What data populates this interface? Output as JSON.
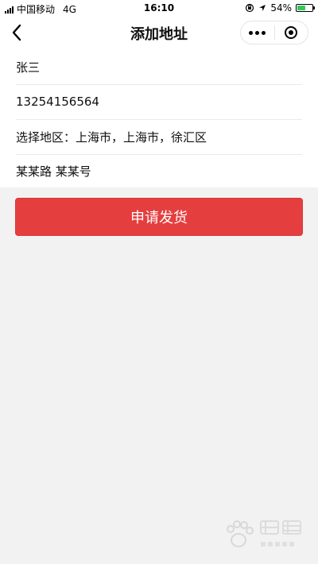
{
  "status_bar": {
    "carrier": "中国移动",
    "network": "4G",
    "time": "16:10",
    "battery_percent": "54%",
    "battery_level": 0.54
  },
  "nav": {
    "title": "添加地址"
  },
  "form": {
    "name": "张三",
    "phone": "13254156564",
    "region_label": "选择地区：",
    "region_value": "上海市，上海市，徐汇区",
    "address": "某某路 某某号"
  },
  "actions": {
    "submit_label": "申请发货"
  },
  "colors": {
    "accent": "#e53e3f",
    "background": "#f2f2f2",
    "battery": "#35c759"
  },
  "icons": {
    "back": "chevron-left-icon",
    "more": "more-dots-icon",
    "close": "target-close-icon",
    "watermark": "baidu-jingyan-watermark"
  }
}
